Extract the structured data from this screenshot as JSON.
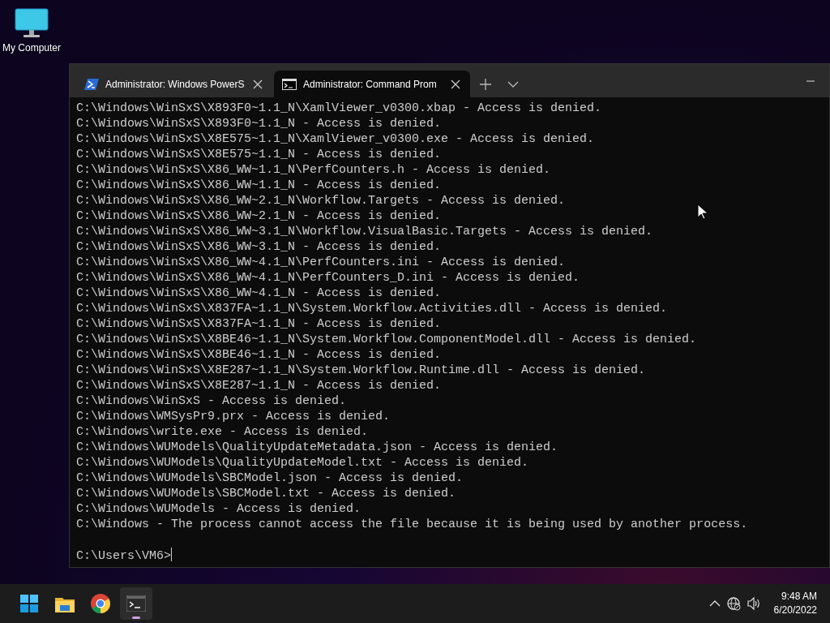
{
  "desktop_icons": [
    {
      "label": "My Computer"
    }
  ],
  "terminal": {
    "tabs": [
      {
        "kind": "powershell",
        "label": "Administrator: Windows PowerS",
        "selected": false
      },
      {
        "kind": "cmd",
        "label": "Administrator: Command Prom",
        "selected": true
      }
    ],
    "lines": [
      "C:\\Windows\\WinSxS\\X893F0~1.1_N\\XamlViewer_v0300.xbap - Access is denied.",
      "C:\\Windows\\WinSxS\\X893F0~1.1_N - Access is denied.",
      "C:\\Windows\\WinSxS\\X8E575~1.1_N\\XamlViewer_v0300.exe - Access is denied.",
      "C:\\Windows\\WinSxS\\X8E575~1.1_N - Access is denied.",
      "C:\\Windows\\WinSxS\\X86_WW~1.1_N\\PerfCounters.h - Access is denied.",
      "C:\\Windows\\WinSxS\\X86_WW~1.1_N - Access is denied.",
      "C:\\Windows\\WinSxS\\X86_WW~2.1_N\\Workflow.Targets - Access is denied.",
      "C:\\Windows\\WinSxS\\X86_WW~2.1_N - Access is denied.",
      "C:\\Windows\\WinSxS\\X86_WW~3.1_N\\Workflow.VisualBasic.Targets - Access is denied.",
      "C:\\Windows\\WinSxS\\X86_WW~3.1_N - Access is denied.",
      "C:\\Windows\\WinSxS\\X86_WW~4.1_N\\PerfCounters.ini - Access is denied.",
      "C:\\Windows\\WinSxS\\X86_WW~4.1_N\\PerfCounters_D.ini - Access is denied.",
      "C:\\Windows\\WinSxS\\X86_WW~4.1_N - Access is denied.",
      "C:\\Windows\\WinSxS\\X837FA~1.1_N\\System.Workflow.Activities.dll - Access is denied.",
      "C:\\Windows\\WinSxS\\X837FA~1.1_N - Access is denied.",
      "C:\\Windows\\WinSxS\\X8BE46~1.1_N\\System.Workflow.ComponentModel.dll - Access is denied.",
      "C:\\Windows\\WinSxS\\X8BE46~1.1_N - Access is denied.",
      "C:\\Windows\\WinSxS\\X8E287~1.1_N\\System.Workflow.Runtime.dll - Access is denied.",
      "C:\\Windows\\WinSxS\\X8E287~1.1_N - Access is denied.",
      "C:\\Windows\\WinSxS - Access is denied.",
      "C:\\Windows\\WMSysPr9.prx - Access is denied.",
      "C:\\Windows\\write.exe - Access is denied.",
      "C:\\Windows\\WUModels\\QualityUpdateMetadata.json - Access is denied.",
      "C:\\Windows\\WUModels\\QualityUpdateModel.txt - Access is denied.",
      "C:\\Windows\\WUModels\\SBCModel.json - Access is denied.",
      "C:\\Windows\\WUModels\\SBCModel.txt - Access is denied.",
      "C:\\Windows\\WUModels - Access is denied.",
      "C:\\Windows - The process cannot access the file because it is being used by another process."
    ],
    "prompt": "C:\\Users\\VM6>"
  },
  "taskbar": {
    "apps": [
      {
        "kind": "start",
        "active": false
      },
      {
        "kind": "explorer",
        "active": false
      },
      {
        "kind": "chrome",
        "active": false
      },
      {
        "kind": "terminal",
        "active": true
      }
    ],
    "time": "9:48 AM",
    "date": "6/20/2022"
  }
}
